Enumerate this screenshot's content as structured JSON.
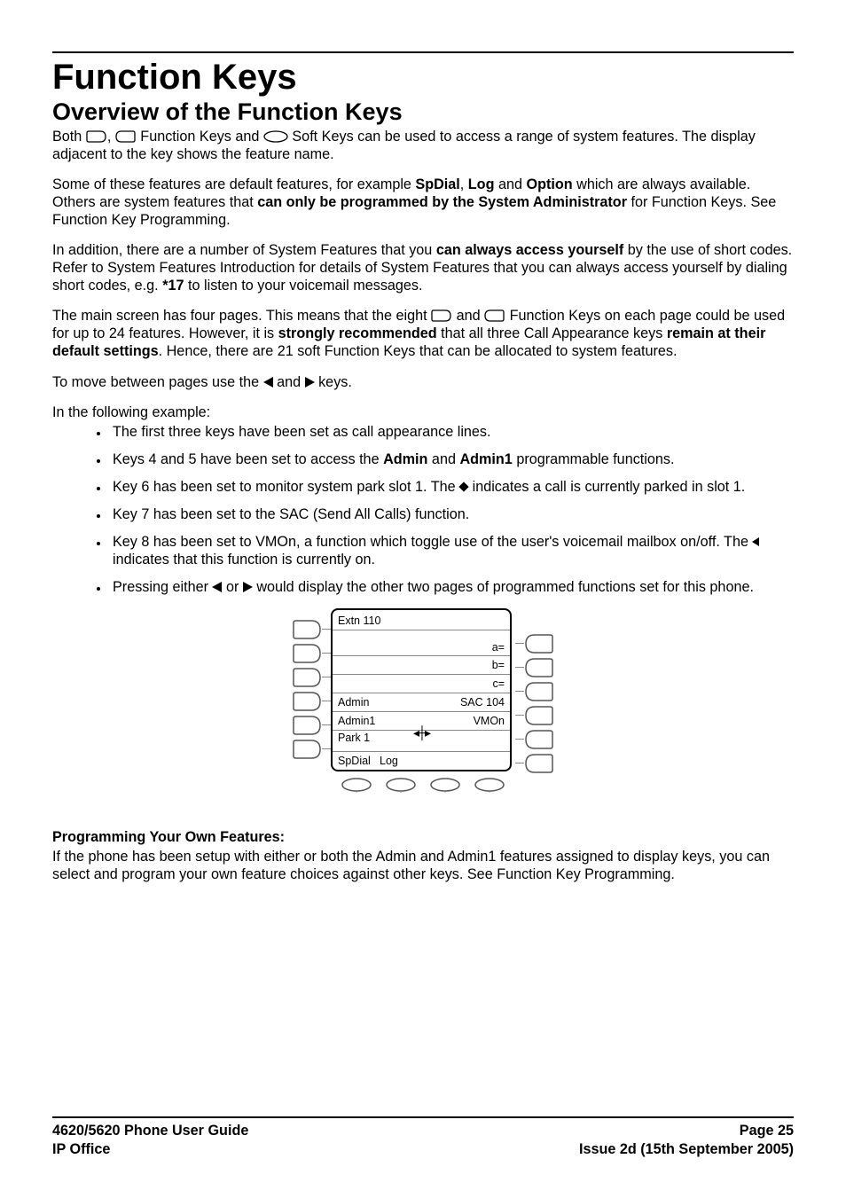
{
  "headings": {
    "h1": "Function Keys",
    "h2": "Overview of the Function Keys",
    "prog_heading": "Programming Your Own Features:"
  },
  "paras": {
    "p1a": "Both ",
    "p1b": ", ",
    "p1c": " Function Keys and ",
    "p1d": " Soft Keys can be used to access a range of system features. The display adjacent to the key shows the feature name.",
    "p2a": "Some of these features are default features, for example ",
    "p2_sp": "SpDial",
    "p2_sep1": ", ",
    "p2_log": "Log",
    "p2_sep2": " and ",
    "p2_opt": "Option",
    "p2b": " which are always available. Others are system features that ",
    "p2_bold": "can only be programmed by the System Administrator",
    "p2c": " for Function Keys. See Function Key Programming.",
    "p3a": "In addition, there are a number of System Features that you ",
    "p3_bold": "can always access yourself",
    "p3b": " by the use of short codes. Refer to System Features Introduction for details of System Features that you can always access yourself by dialing short codes, e.g. ",
    "p3_code": "*17",
    "p3c": " to listen to your voicemail messages.",
    "p4a": "The main screen has four pages. This means that the eight ",
    "p4b": " and ",
    "p4c": " Function Keys on each page could be used for up to 24 features. However, it is ",
    "p4_bold1": "strongly recommended",
    "p4d": " that all three Call Appearance keys ",
    "p4_bold2": "remain at their default settings",
    "p4e": ". Hence, there are 21 soft Function Keys that can be allocated to system features.",
    "p5a": "To move between pages use the ",
    "p5b": " and ",
    "p5c": " keys.",
    "p6": "In the following example:",
    "prog_body": "If the phone has been setup with either or both the Admin and Admin1 features assigned to display keys, you can select and program your own feature choices against other keys. See Function Key Programming."
  },
  "bullets": {
    "b1": "The first three keys have been set as call appearance lines.",
    "b2a": "Keys 4 and 5 have been set to access the ",
    "b2_admin": "Admin",
    "b2_and": " and ",
    "b2_admin1": "Admin1",
    "b2b": " programmable functions.",
    "b3a": "Key 6 has been set to monitor system park slot 1. The ",
    "b3b": " indicates a call is currently parked in slot 1.",
    "b4": "Key 7 has been set to the SAC (Send All Calls) function.",
    "b5a": "Key 8 has been set to VMOn, a function which toggle use of the user's voicemail mailbox on/off. The ",
    "b5b": " indicates that this function is currently on.",
    "b6a": "Pressing either ",
    "b6b": " or ",
    "b6c": " would display the other two pages of programmed functions set for this phone."
  },
  "screen": {
    "title": "Extn 110",
    "r1r": "a=",
    "r2r": "b=",
    "r3r": "c=",
    "r4l": "Admin",
    "r4r": "SAC 104",
    "r5l": "Admin1",
    "r5r": "VMOn",
    "r6l": "Park 1",
    "soft1": "SpDial",
    "soft2": "Log"
  },
  "footer": {
    "l1l": "4620/5620 Phone User Guide",
    "l1r": "Page 25",
    "l2l": "IP Office",
    "l2r": "Issue 2d (15th September 2005)"
  },
  "chart_data": {
    "type": "table",
    "title": "Phone display example — function key assignments",
    "columns": [
      "left_label",
      "right_label"
    ],
    "rows": [
      [
        "Extn 110",
        ""
      ],
      [
        "",
        "a="
      ],
      [
        "",
        "b="
      ],
      [
        "",
        "c="
      ],
      [
        "Admin",
        "SAC 104"
      ],
      [
        "Admin1",
        "VMOn"
      ],
      [
        "Park 1",
        ""
      ]
    ],
    "softkeys": [
      "SpDial",
      "Log",
      "",
      ""
    ]
  }
}
